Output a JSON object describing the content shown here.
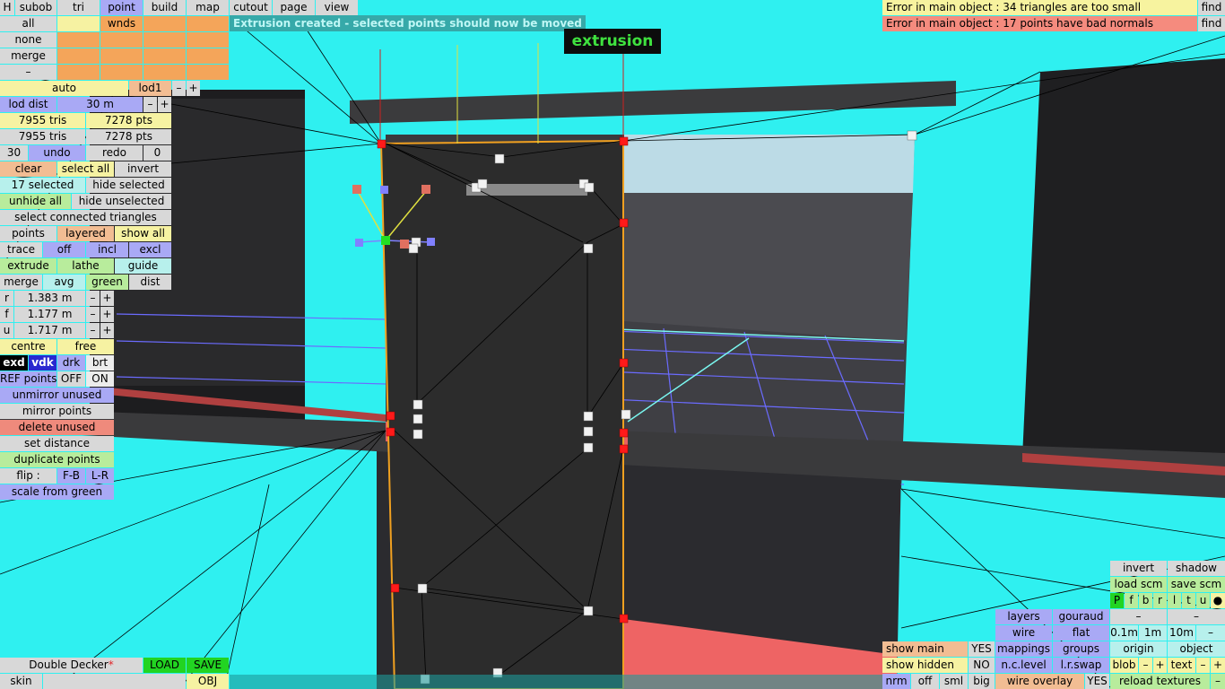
{
  "top_tabs": [
    "H",
    "subob",
    "tri",
    "point",
    "build",
    "map",
    "cutout",
    "page",
    "view"
  ],
  "top_tab_active": "point",
  "select_filters": {
    "all": "all",
    "wnds": "wnds",
    "none": "none",
    "merge": "merge",
    "minus": "–"
  },
  "lod": {
    "auto": "auto",
    "lod1": "lod1",
    "minus": "–",
    "plus": "+",
    "lod_dist_label": "lod dist",
    "lod_dist_value": "30 m"
  },
  "counts": {
    "tris1": "7955 tris",
    "pts1": "7278 pts",
    "tris2": "7955 tris",
    "pts2": "7278 pts"
  },
  "undo_row": {
    "count_left": "30",
    "undo": "undo",
    "redo": "redo",
    "count_right": "0"
  },
  "selection": {
    "clear": "clear",
    "select_all": "select all",
    "invert": "invert",
    "selected_count": "17 selected",
    "hide_selected": "hide selected",
    "unhide_all": "unhide all",
    "hide_unselected": "hide unselected",
    "select_connected": "select connected triangles"
  },
  "points_row": {
    "points": "points",
    "layered": "layered",
    "show_all": "show all"
  },
  "trace_row": {
    "trace": "trace",
    "off": "off",
    "incl": "incl",
    "excl": "excl"
  },
  "tools_row": {
    "extrude": "extrude",
    "lathe": "lathe",
    "guide": "guide"
  },
  "merge_row": {
    "merge": "merge",
    "avg": "avg",
    "green": "green",
    "dist": "dist"
  },
  "dims": [
    {
      "axis": "r",
      "value": "1.383 m",
      "minus": "–",
      "plus": "+"
    },
    {
      "axis": "f",
      "value": "1.177 m",
      "minus": "–",
      "plus": "+"
    },
    {
      "axis": "u",
      "value": "1.717 m",
      "minus": "–",
      "plus": "+"
    }
  ],
  "pivot_row": {
    "centre": "centre",
    "free": "free"
  },
  "view_modes": {
    "exd": "exd",
    "vdk": "vdk",
    "drk": "drk",
    "brt": "brt"
  },
  "ref_row": {
    "label": "REF points",
    "off": "OFF",
    "on": "ON"
  },
  "actions": {
    "unmirror_unused": "unmirror unused",
    "mirror_points": "mirror points",
    "delete_unused": "delete unused",
    "set_distance": "set distance",
    "duplicate_points": "duplicate points",
    "flip_label": "flip :",
    "flip_fb": "F-B",
    "flip_lr": "L-R",
    "scale_from_green": "scale from green"
  },
  "status_message": "Extrusion created - selected points should now be moved",
  "mode_label": "extrusion",
  "errors": [
    {
      "text": "Error in main object : 34 triangles are too small",
      "find": "find"
    },
    {
      "text": "Error in main object : 17 points have bad normals",
      "find": "find"
    }
  ],
  "bottom_left": {
    "object_name": "Double Decker",
    "modified_mark": "*",
    "load": "LOAD",
    "save": "SAVE",
    "skin": "skin",
    "obj": "OBJ"
  },
  "bottom_right": {
    "invert": "invert",
    "shadow": "shadow",
    "load_scm": "load scm",
    "save_scm": "save scm",
    "lights": [
      "P",
      "f",
      "b",
      "r",
      "l",
      "t",
      "u",
      "●"
    ],
    "layers": "layers",
    "gouraud": "gouraud",
    "dash1": "–",
    "dash2": "–",
    "wire": "wire",
    "flat": "flat",
    "d01": "0.1m",
    "d1": "1m",
    "d10": "10m",
    "dminus": "–",
    "show_main": "show main",
    "yes1": "YES",
    "mappings": "mappings",
    "groups": "groups",
    "origin": "origin",
    "object": "object",
    "show_hidden": "show hidden",
    "no": "NO",
    "nc_level": "n.c.level",
    "lr_swap": "l.r.swap",
    "blob": "blob",
    "blob_minus": "–",
    "blob_plus": "+",
    "text": "text",
    "text_minus": "–",
    "text_plus": "+",
    "nrm": "nrm",
    "off": "off",
    "sml": "sml",
    "big": "big",
    "wire_overlay": "wire overlay",
    "yes2": "YES",
    "reload_textures": "reload textures",
    "reload_minus": "–"
  },
  "colors": {
    "sky": "#2ff0f0",
    "selected_point": "#ff1a1a",
    "active_point": "#22e022",
    "accent": "#a9a9f5"
  }
}
